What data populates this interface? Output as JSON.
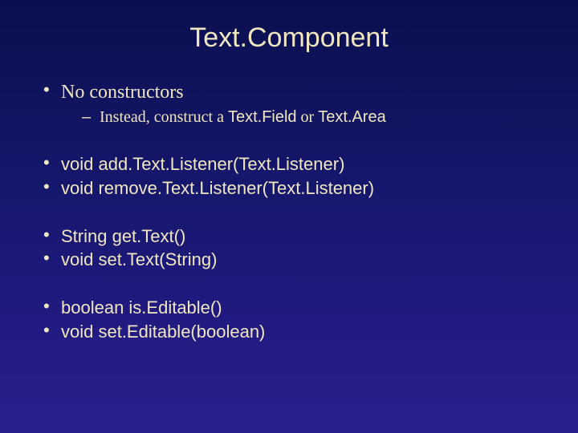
{
  "title": "Text.Component",
  "b1": {
    "text": "No constructors",
    "sub_pre": "Instead, construct a ",
    "sub_code1": "Text.Field",
    "sub_mid": " or ",
    "sub_code2": "Text.Area"
  },
  "b2": "void add.Text.Listener(Text.Listener)",
  "b3": "void remove.Text.Listener(Text.Listener)",
  "b4": "String get.Text()",
  "b5": "void set.Text(String)",
  "b6": "boolean is.Editable()",
  "b7": "void set.Editable(boolean)"
}
